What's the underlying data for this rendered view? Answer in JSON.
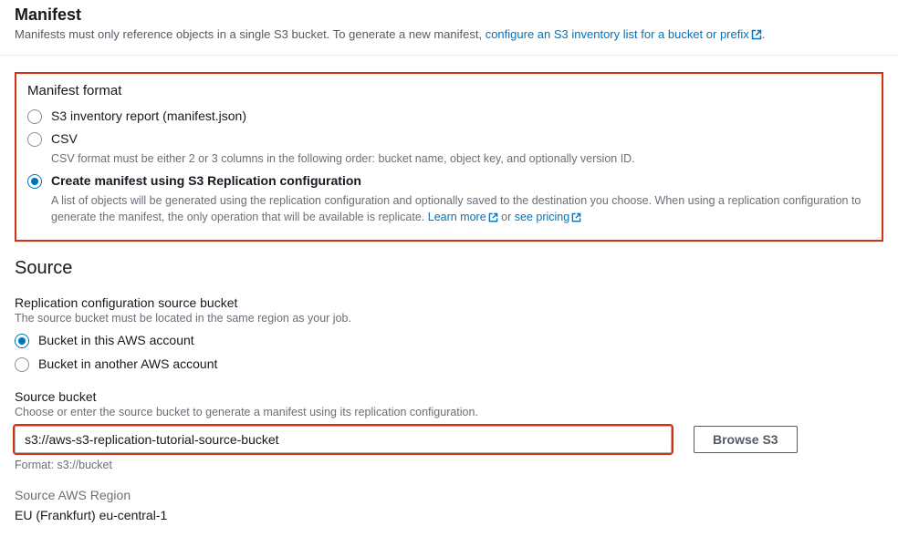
{
  "manifest": {
    "title": "Manifest",
    "desc_prefix": "Manifests must only reference objects in a single S3 bucket. To generate a new manifest, ",
    "desc_link": "configure an S3 inventory list for a bucket or prefix",
    "desc_suffix": "."
  },
  "format": {
    "title": "Manifest format",
    "options": {
      "inventory": {
        "label": "S3 inventory report (manifest.json)"
      },
      "csv": {
        "label": "CSV",
        "help": "CSV format must be either 2 or 3 columns in the following order: bucket name, object key, and optionally version ID."
      },
      "replication": {
        "label": "Create manifest using S3 Replication configuration",
        "help_prefix": "A list of objects will be generated using the replication configuration and optionally saved to the destination you choose. When using a replication configuration to generate the manifest, the only operation that will be available is replicate. ",
        "learn_more": "Learn more",
        "help_mid": " or ",
        "see_pricing": "see pricing"
      }
    }
  },
  "source": {
    "title": "Source",
    "repl_src": {
      "label": "Replication configuration source bucket",
      "help": "The source bucket must be located in the same region as your job.",
      "opt_this": "Bucket in this AWS account",
      "opt_other": "Bucket in another AWS account"
    },
    "bucket": {
      "label": "Source bucket",
      "help": "Choose or enter the source bucket to generate a manifest using its replication configuration.",
      "value": "s3://aws-s3-replication-tutorial-source-bucket",
      "browse": "Browse S3",
      "format_hint": "Format: s3://bucket"
    },
    "region": {
      "label": "Source AWS Region",
      "value": "EU (Frankfurt) eu-central-1"
    }
  }
}
